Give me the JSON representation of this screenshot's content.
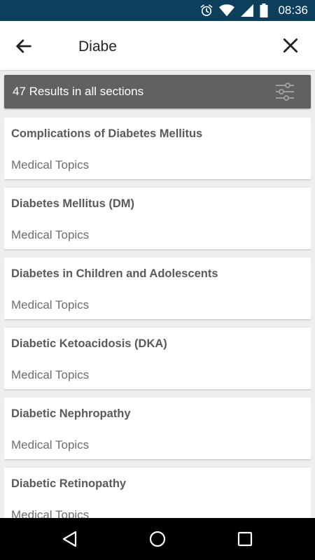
{
  "status_bar": {
    "time": "08:36",
    "icons": [
      "alarm-icon",
      "wifi-icon",
      "signal-icon",
      "battery-icon"
    ]
  },
  "app_bar": {
    "search_value": "Diabe",
    "back_icon": "arrow-left-icon",
    "close_icon": "close-icon"
  },
  "results_bar": {
    "label": "47 Results in all sections",
    "filter_icon": "sliders-icon"
  },
  "results": [
    {
      "title": "Complications of Diabetes Mellitus",
      "section": "Medical Topics"
    },
    {
      "title": "Diabetes Mellitus (DM)",
      "section": "Medical Topics"
    },
    {
      "title": "Diabetes in Children and Adolescents",
      "section": "Medical Topics"
    },
    {
      "title": "Diabetic Ketoacidosis (DKA)",
      "section": "Medical Topics"
    },
    {
      "title": "Diabetic Nephropathy",
      "section": "Medical Topics"
    },
    {
      "title": "Diabetic Retinopathy",
      "section": "Medical Topics"
    }
  ],
  "nav_bar": {
    "icons": [
      "back-triangle-icon",
      "home-circle-icon",
      "recents-square-icon"
    ]
  },
  "colors": {
    "status_bar_bg": "#0c3f5c",
    "results_bar_bg": "#616161",
    "card_bg": "#ffffff",
    "page_bg": "#eeeeee"
  }
}
